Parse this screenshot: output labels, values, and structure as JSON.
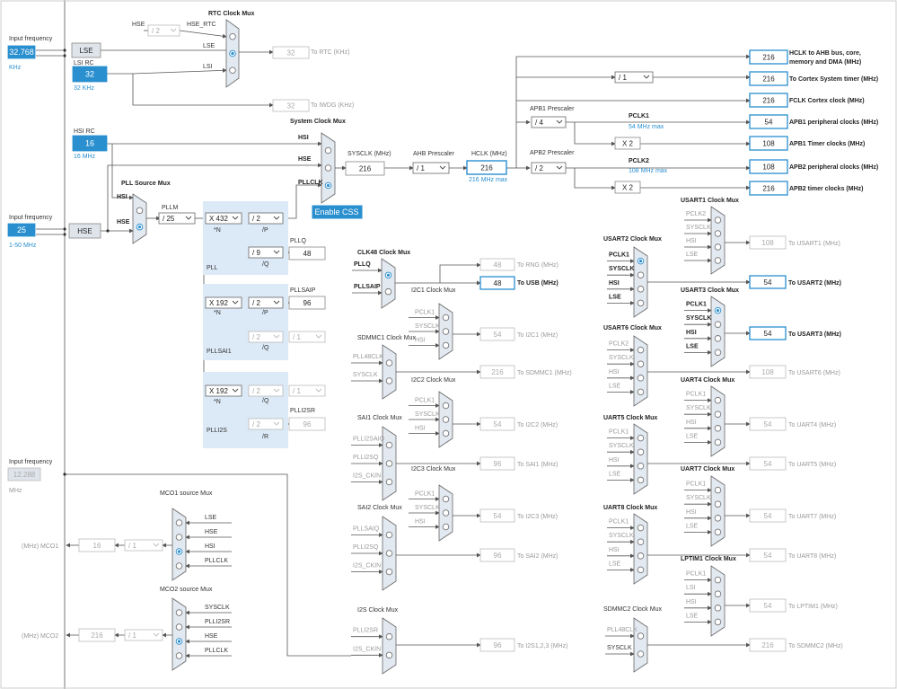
{
  "colors": {
    "accent": "#2a8fcf",
    "pll_bg": "#dbe8f5",
    "mux": "#e0e6ee",
    "line": "#555555",
    "disabled": "#aaaaaa"
  },
  "inputs": {
    "input_frequency_label": "Input frequency",
    "lse_freq": "32.768",
    "lse_unit": "KHz",
    "lse_label": "LSE",
    "lsi_rc_label": "LSI RC",
    "lsi_value": "32",
    "lsi_unit": "32 KHz",
    "hsi_rc_label": "HSI RC",
    "hsi_value": "16",
    "hsi_unit": "16 MHz",
    "hse_freq": "25",
    "hse_range": "1-50 MHz",
    "hse_label": "HSE",
    "ext_freq": "12.288",
    "ext_unit": "MHz"
  },
  "rtc": {
    "title": "RTC Clock Mux",
    "hse_label": "HSE",
    "hse_rtc_label": "HSE_RTC",
    "div": "/ 2",
    "lse": "LSE",
    "lsi": "LSI",
    "rtc_value": "32",
    "rtc_label": "To RTC (KHz)",
    "iwdg_value": "32",
    "iwdg_label": "To IWDG (KHz)"
  },
  "sysmux": {
    "title": "System Clock Mux",
    "hsi": "HSI",
    "hse": "HSE",
    "pllclk": "PLLCLK",
    "enable_css": "Enable CSS"
  },
  "sys": {
    "sysclk_label": "SYSCLK (MHz)",
    "sysclk": "216",
    "ahb_label": "AHB Prescaler",
    "ahb": "/ 1",
    "hclk_label": "HCLK (MHz)",
    "hclk": "216",
    "hclk_max": "216 MHz max"
  },
  "apb": {
    "apb1_label": "APB1 Prescaler",
    "apb1": "/ 4",
    "apb2_label": "APB2 Prescaler",
    "apb2": "/ 2",
    "cortex_div": "/ 1",
    "x2a": "X 2",
    "x2b": "X 2",
    "pclk1": "PCLK1",
    "pclk1_max": "54 MHz max",
    "pclk2": "PCLK2",
    "pclk2_max": "108 MHz max"
  },
  "outputs": [
    {
      "value": "216",
      "label": "HCLK to AHB bus, core,"
    },
    {
      "value": "216",
      "label": "To Cortex System timer (MHz)"
    },
    {
      "value": "216",
      "label": "FCLK Cortex clock (MHz)"
    },
    {
      "value": "54",
      "label": "APB1 peripheral clocks (MHz)"
    },
    {
      "value": "108",
      "label": "APB1 Timer clocks (MHz)"
    },
    {
      "value": "108",
      "label": "APB2 peripheral clocks (MHz)"
    },
    {
      "value": "216",
      "label": "APB2 timer clocks (MHz)"
    }
  ],
  "hclk_label2": "memory and DMA (MHz)",
  "pll": {
    "source_title": "PLL Source Mux",
    "hsi": "HSI",
    "hse": "HSE",
    "pllm_label": "PLLM",
    "pllm": "/ 25",
    "n": "X 432",
    "n_lbl": "*N",
    "p": "/ 2",
    "p_lbl": "/P",
    "q": "/ 9",
    "q_lbl": "/Q",
    "pllq_label": "PLLQ",
    "pllq": "48",
    "name": "PLL"
  },
  "pllsai": {
    "n": "X 192",
    "n_lbl": "*N",
    "p": "/ 2",
    "p_lbl": "/P",
    "q": "/ 2",
    "q_lbl": "/Q",
    "qdiv": "/ 1",
    "pllsaip_label": "PLLSAIP",
    "pllsaip": "96",
    "name": "PLLSAI1"
  },
  "plli2s": {
    "n": "X 192",
    "n_lbl": "*N",
    "q": "/ 2",
    "q_lbl": "/Q",
    "qdiv": "/ 1",
    "r": "/ 2",
    "r_lbl": "/R",
    "plli2sr_label": "PLLI2SR",
    "plli2sr": "96",
    "name": "PLLI2S"
  },
  "clk48": {
    "title": "CLK48 Clock Mux",
    "pllq": "PLLQ",
    "pllsaip": "PLLSAIP",
    "rng": "48",
    "rng_label": "To RNG (MHz)",
    "usb": "48",
    "usb_label": "To USB (MHz)"
  },
  "sdmmc1": {
    "title": "SDMMC1 Clock Mux",
    "in1": "PLL48CLK",
    "in2": "SYSCLK",
    "value": "216",
    "label": "To SDMMC1 (MHz)"
  },
  "sai1": {
    "title": "SAI1 Clock Mux",
    "in1": "PLLI2SAIQ",
    "in2": "PLLI2SQ",
    "in3": "I2S_CKIN",
    "value": "96",
    "label": "To SAI1 (MHz)"
  },
  "sai2": {
    "title": "SAI2 Clock Mux",
    "in1": "PLLSAIQ",
    "in2": "PLLI2SQ",
    "in3": "I2S_CKIN",
    "value": "96",
    "label": "To SAI2 (MHz)"
  },
  "i2s": {
    "title": "I2S Clock Mux",
    "in1": "PLLI2SR",
    "in2": "I2S_CKIN",
    "value": "96",
    "label": "To I2S1,2,3 (MHz)"
  },
  "i2c1": {
    "title": "I2C1 Clock Mux",
    "value": "54",
    "label": "To I2C1 (MHz)"
  },
  "i2c2": {
    "title": "I2C2 Clock Mux",
    "value": "54",
    "label": "To I2C2 (MHz)"
  },
  "i2c3": {
    "title": "I2C3 Clock Mux",
    "value": "54",
    "label": "To I2C3 (MHz)"
  },
  "i2c_inputs": [
    "PCLK1",
    "SYSCLK",
    "HSI"
  ],
  "mco1": {
    "title": "MCO1 source Mux",
    "inputs": [
      "LSE",
      "HSE",
      "HSI",
      "PLLCLK"
    ],
    "div": "/ 1",
    "value": "16",
    "label": "(MHz) MCO1"
  },
  "mco2": {
    "title": "MCO2 source Mux",
    "inputs": [
      "SYSCLK",
      "PLLI2SR",
      "HSE",
      "PLLCLK"
    ],
    "div": "/ 1",
    "value": "216",
    "label": "(MHz) MCO2"
  },
  "usart1": {
    "title": "USART1 Clock Mux",
    "inputs": [
      "PCLK2",
      "SYSCLK",
      "HSI",
      "LSE"
    ],
    "value": "108",
    "label": "To USART1 (MHz)"
  },
  "usart2": {
    "title": "USART2 Clock Mux",
    "inputs": [
      "PCLK1",
      "SYSCLK",
      "HSI",
      "LSE"
    ],
    "value": "54",
    "label": "To USART2 (MHz)"
  },
  "usart3": {
    "title": "USART3 Clock Mux",
    "inputs": [
      "PCLK1",
      "SYSCLK",
      "HSI",
      "LSE"
    ],
    "value": "54",
    "label": "To USART3 (MHz)"
  },
  "usart6": {
    "title": "USART6 Clock Mux",
    "inputs": [
      "PCLK2",
      "SYSCLK",
      "HSI",
      "LSE"
    ],
    "value": "108",
    "label": "To USART6 (MHz)"
  },
  "uart4": {
    "title": "UART4 Clock Mux",
    "inputs": [
      "PCLK1",
      "SYSCLK",
      "HSI",
      "LSE"
    ],
    "value": "54",
    "label": "To UART4 (MHz)"
  },
  "uart5": {
    "title": "UART5 Clock Mux",
    "inputs": [
      "PCLK1",
      "SYSCLK",
      "HSI",
      "LSE"
    ],
    "value": "54",
    "label": "To UART5 (MHz)"
  },
  "uart7": {
    "title": "UART7 Clock Mux",
    "inputs": [
      "PCLK1",
      "SYSCLK",
      "HSI",
      "LSE"
    ],
    "value": "54",
    "label": "To UART7 (MHz)"
  },
  "uart8": {
    "title": "UART8 Clock Mux",
    "inputs": [
      "PCLK1",
      "SYSCLK",
      "HSI",
      "LSE"
    ],
    "value": "54",
    "label": "To UART8 (MHz)"
  },
  "lptim1": {
    "title": "LPTIM1 Clock Mux",
    "inputs": [
      "PCLK1",
      "LSI",
      "HSI",
      "LSE"
    ],
    "value": "54",
    "label": "To LPTIM1 (MHz)"
  },
  "sdmmc2": {
    "title": "SDMMC2 Clock Mux",
    "in1": "PLL48CLK",
    "in2": "SYSCLK",
    "value": "216",
    "label": "To SDMMC2 (MHz)"
  }
}
